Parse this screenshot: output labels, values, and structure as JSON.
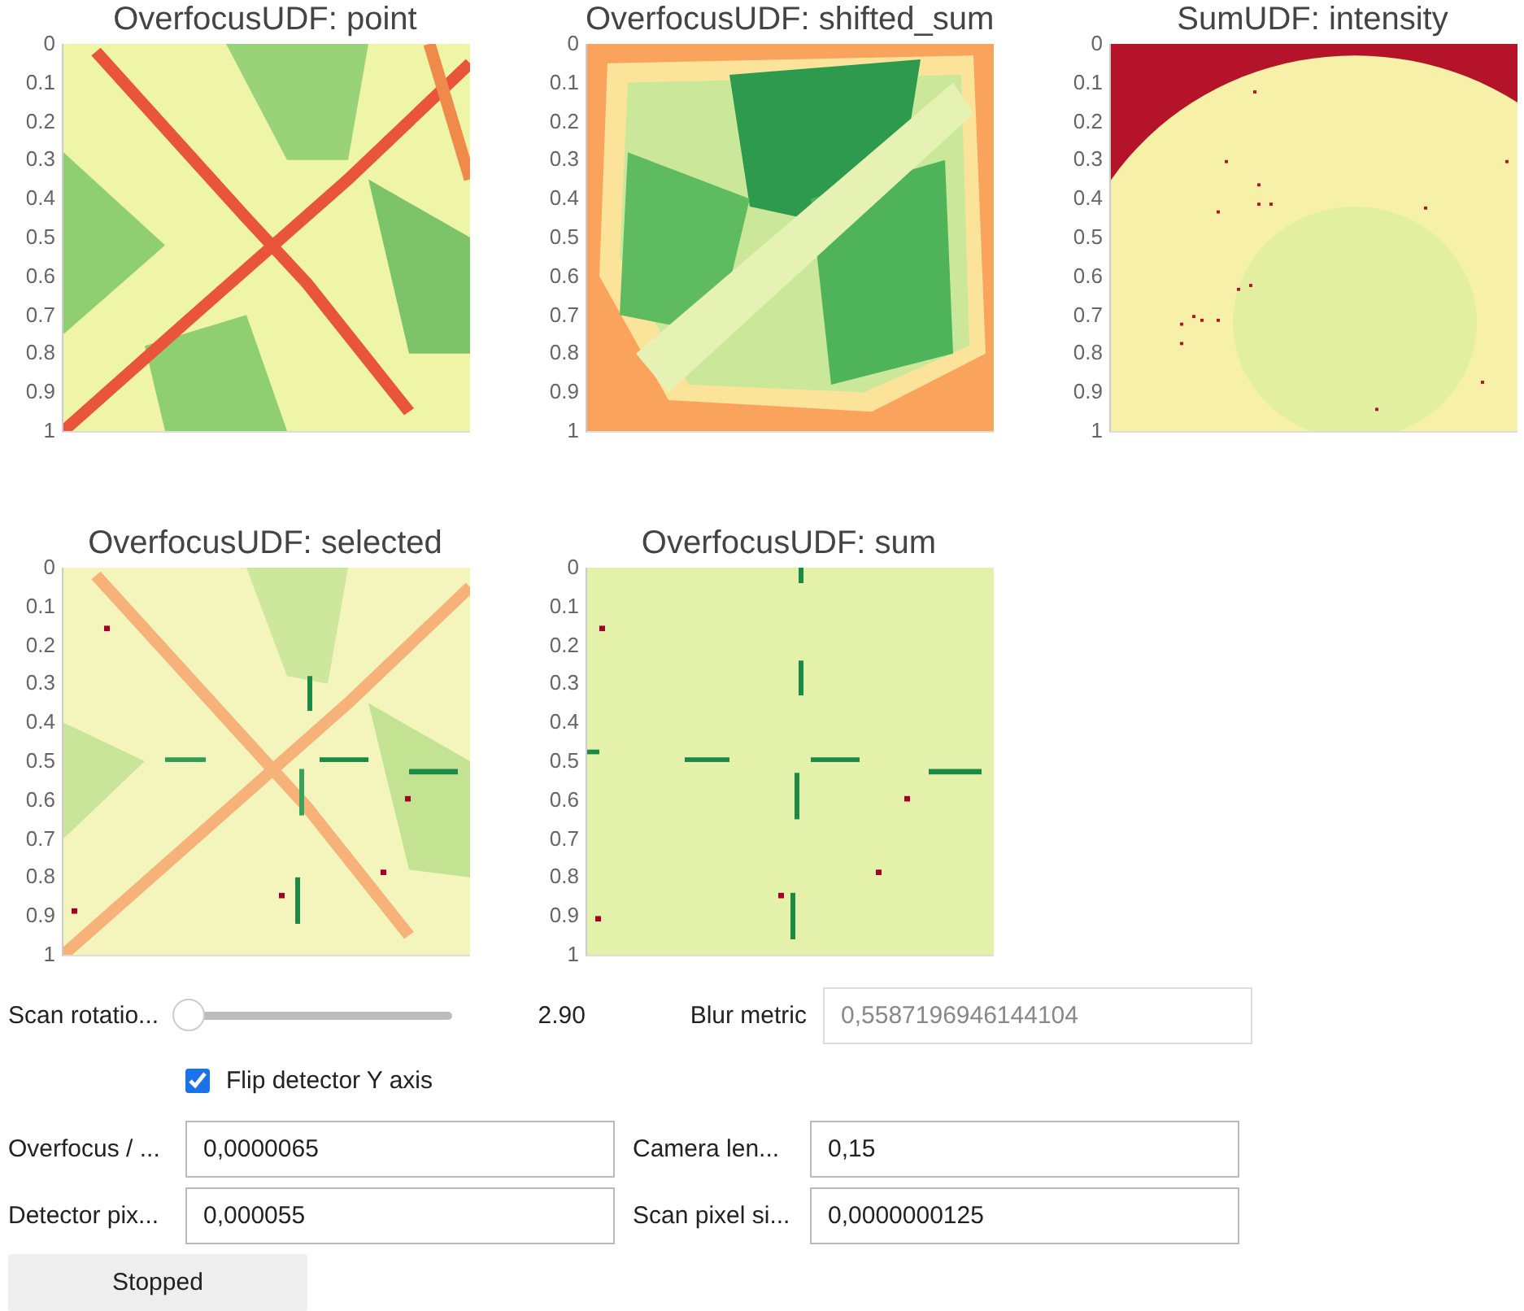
{
  "plots": [
    {
      "title": "OverfocusUDF: point",
      "y_ticks": [
        "0",
        "0.1",
        "0.2",
        "0.3",
        "0.4",
        "0.5",
        "0.6",
        "0.7",
        "0.8",
        "0.9",
        "1"
      ]
    },
    {
      "title": "OverfocusUDF: shifted_sum",
      "y_ticks": [
        "0",
        "0.1",
        "0.2",
        "0.3",
        "0.4",
        "0.5",
        "0.6",
        "0.7",
        "0.8",
        "0.9",
        "1"
      ]
    },
    {
      "title": "SumUDF: intensity",
      "y_ticks": [
        "0",
        "0.1",
        "0.2",
        "0.3",
        "0.4",
        "0.5",
        "0.6",
        "0.7",
        "0.8",
        "0.9",
        "1"
      ]
    },
    {
      "title": "OverfocusUDF: selected",
      "y_ticks": [
        "0",
        "0.1",
        "0.2",
        "0.3",
        "0.4",
        "0.5",
        "0.6",
        "0.7",
        "0.8",
        "0.9",
        "1"
      ]
    },
    {
      "title": "OverfocusUDF: sum",
      "y_ticks": [
        "0",
        "0.1",
        "0.2",
        "0.3",
        "0.4",
        "0.5",
        "0.6",
        "0.7",
        "0.8",
        "0.9",
        "1"
      ]
    }
  ],
  "scan_rotation": {
    "label": "Scan rotatio...",
    "level": 0,
    "reading": "2.90"
  },
  "blur_metric": {
    "label": "Blur metric",
    "value": "0,5587196946144104",
    "disabled": true
  },
  "flip_checkbox": {
    "label": "Flip detector Y axis",
    "checked": true
  },
  "fields": [
    {
      "label": "Overfocus / ...",
      "value": "0,0000065"
    },
    {
      "label": "Camera len...",
      "value": "0,15"
    },
    {
      "label": "Detector pix...",
      "value": "0,000055"
    },
    {
      "label": "Scan pixel si...",
      "value": "0,0000000125"
    }
  ],
  "button": {
    "label": "Stopped"
  }
}
